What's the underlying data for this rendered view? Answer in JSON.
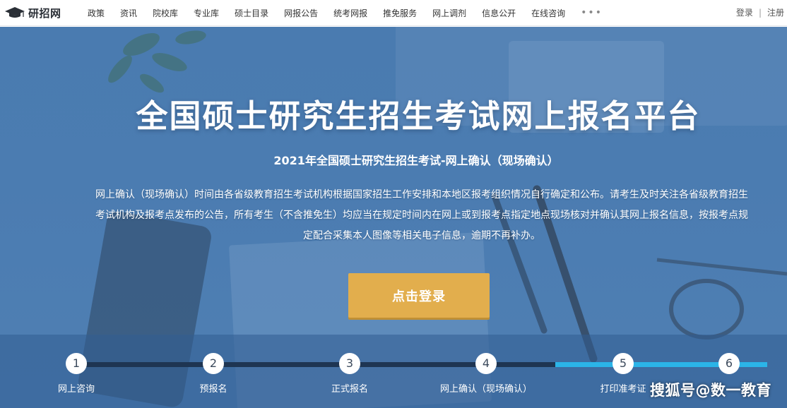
{
  "brand": {
    "name": "研招网",
    "icon": "graduation-cap-icon"
  },
  "nav": {
    "items": [
      "政策",
      "资讯",
      "院校库",
      "专业库",
      "硕士目录",
      "网报公告",
      "统考网报",
      "推免服务",
      "网上调剂",
      "信息公开",
      "在线咨询"
    ],
    "more": "•••"
  },
  "auth": {
    "login": "登录",
    "separator": "|",
    "register": "注册"
  },
  "hero": {
    "title": "全国硕士研究生招生考试网上报名平台",
    "subtitle": "2021年全国硕士研究生招生考试-网上确认（现场确认）",
    "description": "网上确认（现场确认）时间由各省级教育招生考试机构根据国家招生工作安排和本地区报考组织情况自行确定和公布。请考生及时关注各省级教育招生考试机构及报考点发布的公告，所有考生（不含推免生）均应当在规定时间内在网上或到报考点指定地点现场核对并确认其网上报名信息，按报考点规定配合采集本人图像等相关电子信息，逾期不再补办。",
    "button": "点击登录"
  },
  "steps": [
    {
      "num": "1",
      "label": "网上咨询"
    },
    {
      "num": "2",
      "label": "预报名"
    },
    {
      "num": "3",
      "label": "正式报名"
    },
    {
      "num": "4",
      "label": "网上确认（现场确认）"
    },
    {
      "num": "5",
      "label": "打印准考证"
    },
    {
      "num": "6",
      "label": ""
    }
  ],
  "steps_progress": 0.69,
  "watermark": "搜狐号@数一教育",
  "colors": {
    "accent_button": "#e2ae4d",
    "hero_blue": "#4a7bb0",
    "progress_active": "#2bb4e8",
    "progress_track": "#1e3552"
  }
}
